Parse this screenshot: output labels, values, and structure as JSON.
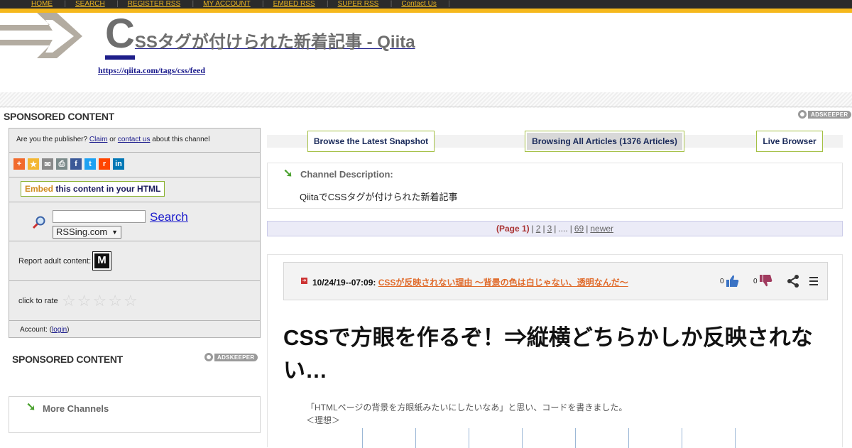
{
  "nav": {
    "items": [
      "HOME",
      "SEARCH",
      "REGISTER RSS",
      "MY ACCOUNT",
      "EMBED RSS",
      "SUPER RSS",
      "Contact Us"
    ]
  },
  "header": {
    "title_initial": "C",
    "title_rest": "SSタグが付けられた新着記事 - Qiita",
    "feed_url": "https://qiita.com/tags/css/feed"
  },
  "sponsored": {
    "label": "SPONSORED CONTENT",
    "adskeeper": "ADSKEEPER"
  },
  "sidebar": {
    "publisher_prefix": "Are you the publisher?",
    "claim": "Claim",
    "or": "or",
    "contact_us": "contact us",
    "publisher_suffix": "about this channel",
    "share_icons": [
      "plus-icon",
      "star-icon",
      "email-icon",
      "print-icon",
      "facebook-icon",
      "twitter-icon",
      "reddit-icon",
      "linkedin-icon"
    ],
    "embed_word": "Embed",
    "embed_rest": "this content in your HTML",
    "search_button": "Search",
    "search_select": "RSSing.com",
    "report_adult": "Report adult content:",
    "mature_badge": "M",
    "rate_label": "click to rate",
    "account_prefix": "Account: (",
    "account_login": "login",
    "account_suffix": ")",
    "more_channels": "More Channels"
  },
  "tabs": {
    "snapshot": "Browse the Latest Snapshot",
    "all_articles": "Browsing All Articles (1376 Articles)",
    "live": "Live Browser"
  },
  "channel": {
    "label": "Channel Description:",
    "description": "QiitaでCSSタグが付けられた新着記事"
  },
  "pager": {
    "current": "(Page 1)",
    "p2": "2",
    "p3": "3",
    "ellipsis": "....",
    "last": "69",
    "newer": "newer",
    "sep": "|"
  },
  "post": {
    "datetime": "10/24/19--07:09:",
    "title": "CSSが反映されない理由 ～背景の色は白じゃない、透明なんだ～",
    "likes": "0",
    "dislikes": "0",
    "headline": "CSSで方眼を作るぞ！⇒縦横どちらかしか反映されない…",
    "snippet_line1": "「HTMLページの背景を方眼紙みたいにしたいなあ」と思い、コードを書きました。",
    "snippet_line2": "＜理想＞"
  }
}
